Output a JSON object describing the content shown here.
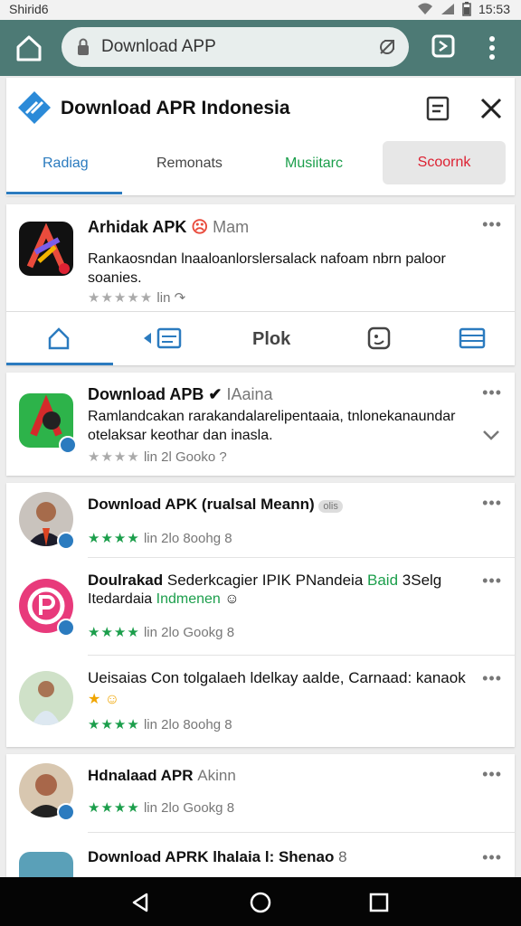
{
  "status": {
    "time_left": "Shirid6",
    "clock": "15:53"
  },
  "browser": {
    "url_text": "Download APP"
  },
  "header": {
    "title": "Download APR Indonesia",
    "tabs": [
      "Radiag",
      "Remonats",
      "Musiitarc",
      "Scoornk"
    ]
  },
  "featured": {
    "name": "Arhidak APK",
    "tag": "Mam",
    "description": "Rankaosndan lnaaloanlorslersalack nafoam nbrn paloor soanies.",
    "meta_left": "lin",
    "actions": [
      "home",
      "share",
      "Plok",
      "video",
      "list"
    ]
  },
  "apps": [
    {
      "name": "Download APB",
      "tag": "IAaina",
      "description": "Ramlandcakan rarakandalarelipentaaia, tnlonekanaundar otelaksar keothar dan inasla.",
      "rating": "lin 2l Gooko",
      "suffix": "?",
      "rating_color": "grey"
    },
    {
      "name": "Download APK (rualsal Meann)",
      "tag": "olis",
      "description": "",
      "rating": "lin 2lo 8oohg",
      "suffix": "8",
      "rating_color": "green"
    },
    {
      "name": "Doulrakad",
      "name_rest": "Sederkcagier IPIK PNandeia",
      "name_green": "Baid",
      "name_rest2": "3Selg",
      "line2": "Itedardaia",
      "line2_green": "Indmenen",
      "rating": "lin 2lo Gookg",
      "suffix": "8",
      "rating_color": "green"
    },
    {
      "name": "Ueisaias Con tolgalaeh ldelkay aalde, Carnaad: kanaok",
      "rating": "lin 2lo 8oohg",
      "suffix": "8",
      "rating_color": "green"
    },
    {
      "name": "Hdnalaad APR",
      "tag": "Akinn",
      "rating": "lin 2lo Gookg",
      "suffix": "8",
      "rating_color": "green"
    },
    {
      "name": "Download APRK lhalaia l: Shenao",
      "suffix": "8"
    }
  ],
  "colors": {
    "toolbar": "#4d7a75",
    "accent": "#2b7bbf",
    "green": "#1b9e4b",
    "red": "#d23"
  }
}
